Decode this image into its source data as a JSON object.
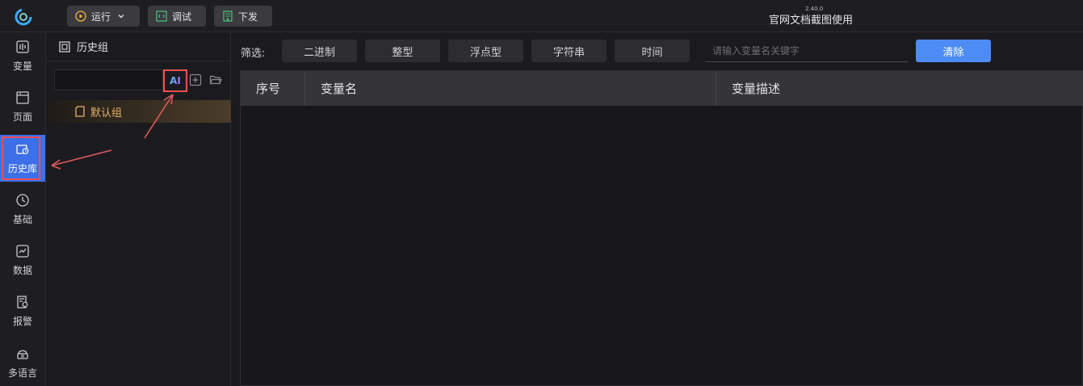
{
  "topbar": {
    "run_label": "运行",
    "debug_label": "调试",
    "deploy_label": "下发",
    "version": "2.40.0",
    "title": "官网文档截图使用"
  },
  "rail": {
    "items": [
      {
        "label": "变量",
        "icon": "variable-icon"
      },
      {
        "label": "页面",
        "icon": "page-icon"
      },
      {
        "label": "历史库",
        "icon": "history-db-icon",
        "active": true
      },
      {
        "label": "基础",
        "icon": "clock-icon"
      },
      {
        "label": "数据",
        "icon": "chart-icon"
      },
      {
        "label": "报警",
        "icon": "alarm-doc-icon"
      },
      {
        "label": "多语言",
        "icon": "language-icon"
      }
    ]
  },
  "group_panel": {
    "title": "历史组",
    "search_value": "",
    "ai_label": "AI",
    "groups": [
      {
        "label": "默认组"
      }
    ]
  },
  "filter": {
    "label": "筛选:",
    "chips": [
      "二进制",
      "整型",
      "浮点型",
      "字符串",
      "时间"
    ],
    "search_placeholder": "请输入变量名关键字",
    "clear_label": "清除"
  },
  "table": {
    "columns": [
      "序号",
      "变量名",
      "变量描述"
    ],
    "rows": []
  },
  "colors": {
    "accent": "#4d8cf5",
    "rail_active": "#3c6fe8",
    "highlight_border": "#ff4d4f",
    "group_text": "#e8b06a"
  }
}
